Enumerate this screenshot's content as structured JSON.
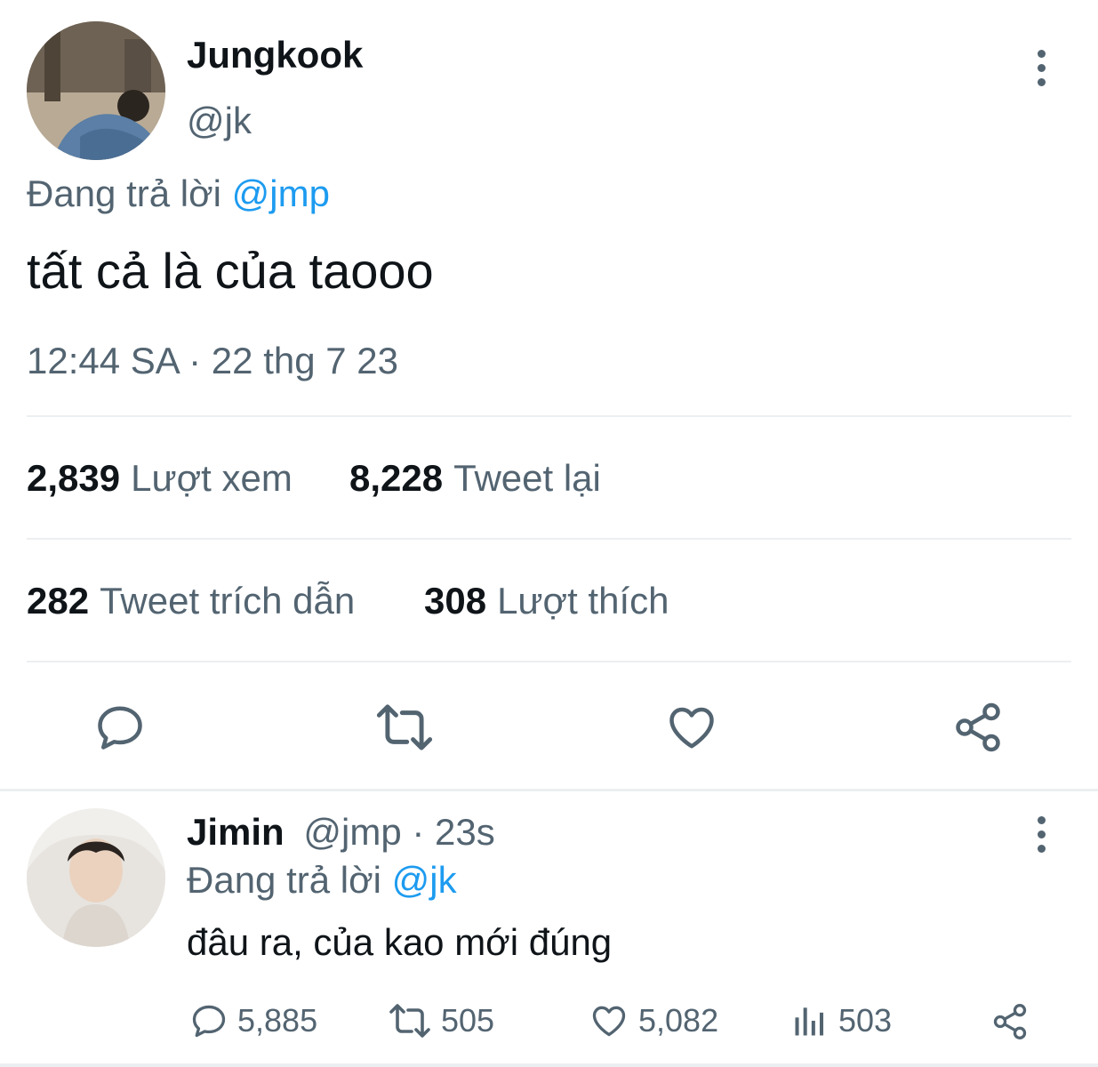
{
  "main_tweet": {
    "author_name": "Jungkook",
    "author_handle": "@jk",
    "replying_prefix": "Đang trả lời",
    "replying_to": "@jmp",
    "text": "tất cả là của taooo",
    "timestamp": "12:44 SA · 22 thg 7 23",
    "stats": {
      "views_count": "2,839",
      "views_label": "Lượt xem",
      "retweets_count": "8,228",
      "retweets_label": "Tweet lại",
      "quotes_count": "282",
      "quotes_label": "Tweet trích dẫn",
      "likes_count": "308",
      "likes_label": "Lượt thích"
    },
    "actions": [
      "reply-icon",
      "retweet-icon",
      "like-icon",
      "share-icon"
    ]
  },
  "reply_tweet": {
    "author_name": "Jimin",
    "author_handle": "@jmp",
    "time": "· 23s",
    "replying_prefix": "Đang trả lời",
    "replying_to": "@jk",
    "text": "đâu ra, của kao mới đúng",
    "actions": {
      "replies": "5,885",
      "retweets": "505",
      "likes": "5,082",
      "views": "503"
    }
  },
  "colors": {
    "text": "#0f1419",
    "secondary": "#536471",
    "accent": "#1d9bf0",
    "divider": "#eceff1"
  }
}
